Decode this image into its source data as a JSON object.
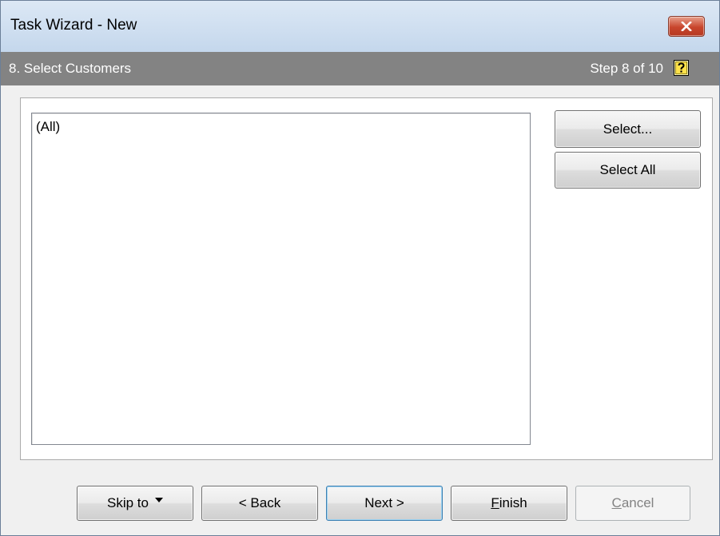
{
  "window": {
    "title": "Task Wizard - New"
  },
  "step": {
    "title": "8. Select Customers",
    "counter": "Step 8 of 10",
    "help_icon": "help-question-icon"
  },
  "list": {
    "items": [
      "(All)"
    ]
  },
  "side_buttons": {
    "select_label": "Select...",
    "select_all_label": "Select All"
  },
  "footer": {
    "skip_to_label": "Skip to",
    "back_label": "< Back",
    "next_label": "Next >",
    "finish_first": "F",
    "finish_rest": "inish",
    "cancel_first": "C",
    "cancel_rest": "ancel"
  },
  "colors": {
    "step_bar": "#838383",
    "close_button": "#c8452c",
    "next_focus_border": "#3c7fb1",
    "disabled_text": "#838383"
  }
}
